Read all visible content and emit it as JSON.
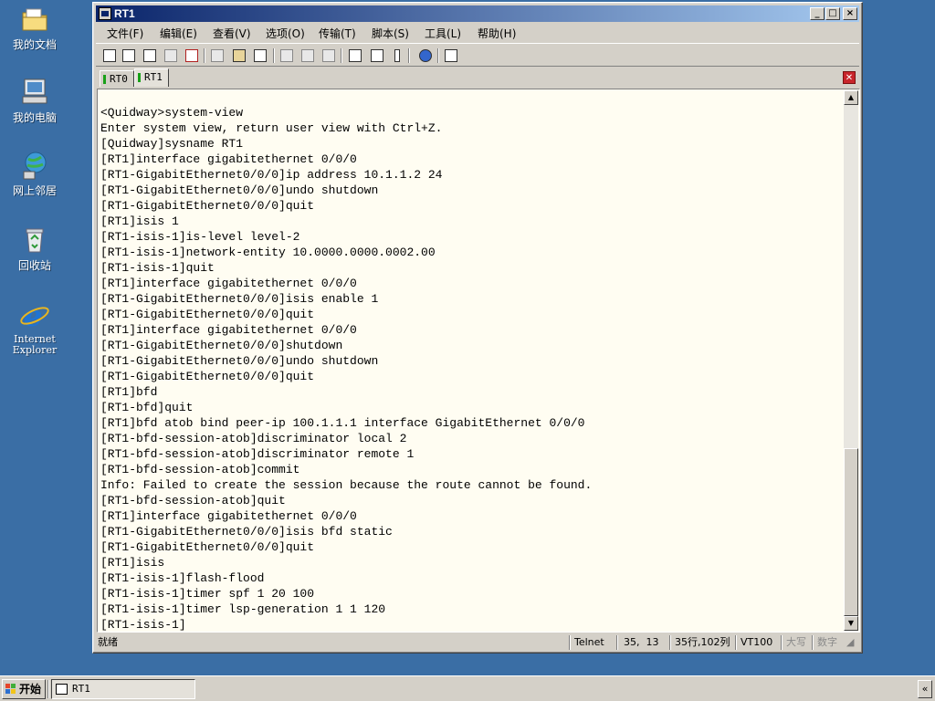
{
  "desktop": {
    "icons": [
      {
        "label": "我的文档",
        "icon": "my-documents-icon"
      },
      {
        "label": "我的电脑",
        "icon": "my-computer-icon"
      },
      {
        "label": "网上邻居",
        "icon": "network-places-icon"
      },
      {
        "label": "回收站",
        "icon": "recycle-bin-icon"
      },
      {
        "label": "Internet\nExplorer",
        "icon": "internet-explorer-icon"
      }
    ]
  },
  "window": {
    "title": "RT1",
    "controls": {
      "minimize": "_",
      "maximize": "□",
      "close": "×"
    }
  },
  "menubar": [
    "文件(F)",
    "编辑(E)",
    "查看(V)",
    "选项(O)",
    "传输(T)",
    "脚本(S)",
    "工具(L)",
    "帮助(H)"
  ],
  "tabs": [
    {
      "label": "RT0",
      "active": false
    },
    {
      "label": "RT1",
      "active": true
    }
  ],
  "terminal": {
    "lines": [
      "<Quidway>system-view",
      "Enter system view, return user view with Ctrl+Z.",
      "[Quidway]sysname RT1",
      "[RT1]interface gigabitethernet 0/0/0",
      "[RT1-GigabitEthernet0/0/0]ip address 10.1.1.2 24",
      "[RT1-GigabitEthernet0/0/0]undo shutdown",
      "[RT1-GigabitEthernet0/0/0]quit",
      "[RT1]isis 1",
      "[RT1-isis-1]is-level level-2",
      "[RT1-isis-1]network-entity 10.0000.0000.0002.00",
      "[RT1-isis-1]quit",
      "[RT1]interface gigabitethernet 0/0/0",
      "[RT1-GigabitEthernet0/0/0]isis enable 1",
      "[RT1-GigabitEthernet0/0/0]quit",
      "[RT1]interface gigabitethernet 0/0/0",
      "[RT1-GigabitEthernet0/0/0]shutdown",
      "[RT1-GigabitEthernet0/0/0]undo shutdown",
      "[RT1-GigabitEthernet0/0/0]quit",
      "[RT1]bfd",
      "[RT1-bfd]quit",
      "[RT1]bfd atob bind peer-ip 100.1.1.1 interface GigabitEthernet 0/0/0",
      "[RT1-bfd-session-atob]discriminator local 2",
      "[RT1-bfd-session-atob]discriminator remote 1",
      "[RT1-bfd-session-atob]commit",
      "Info: Failed to create the session because the route cannot be found.",
      "[RT1-bfd-session-atob]quit",
      "[RT1]interface gigabitethernet 0/0/0",
      "[RT1-GigabitEthernet0/0/0]isis bfd static",
      "[RT1-GigabitEthernet0/0/0]quit",
      "[RT1]isis",
      "[RT1-isis-1]flash-flood",
      "[RT1-isis-1]timer spf 1 20 100",
      "[RT1-isis-1]timer lsp-generation 1 1 120",
      "[RT1-isis-1]"
    ]
  },
  "statusbar": {
    "ready": "就绪",
    "protocol": "Telnet",
    "cursor": "35,  13",
    "size": "35行,102列",
    "emulation": "VT100",
    "caps": "大写",
    "num": "数字"
  },
  "taskbar": {
    "start": "开始",
    "task": "RT1",
    "tray": "«"
  }
}
